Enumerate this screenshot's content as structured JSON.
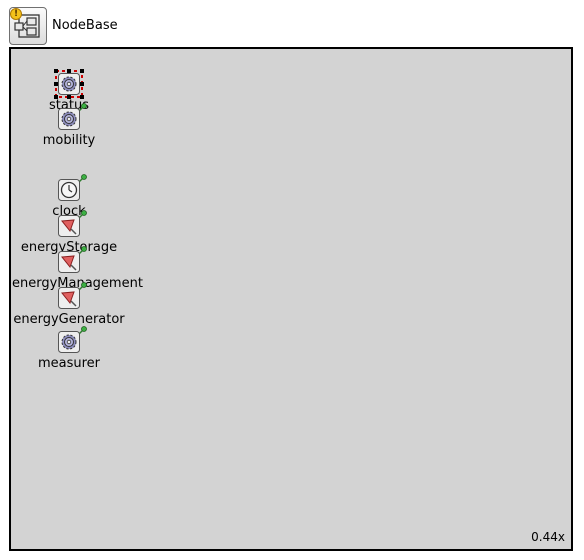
{
  "module": {
    "name": "NodeBase",
    "icon": "compound-module-icon",
    "warning_icon": "warning-icon"
  },
  "canvas": {
    "background": "#d3d3d3",
    "zoom": "0.44x"
  },
  "submodules": [
    {
      "label": "status",
      "icon": "gear-icon",
      "selected": true
    },
    {
      "label": "mobility",
      "icon": "gear-icon"
    },
    {
      "label": "clock",
      "icon": "clock-icon"
    },
    {
      "label": "energyStorage",
      "icon": "energy-icon"
    },
    {
      "label": "energyManagement",
      "icon": "energy-icon"
    },
    {
      "label": "energyGenerator",
      "icon": "energy-icon"
    },
    {
      "label": "measurer",
      "icon": "gear-icon"
    }
  ]
}
